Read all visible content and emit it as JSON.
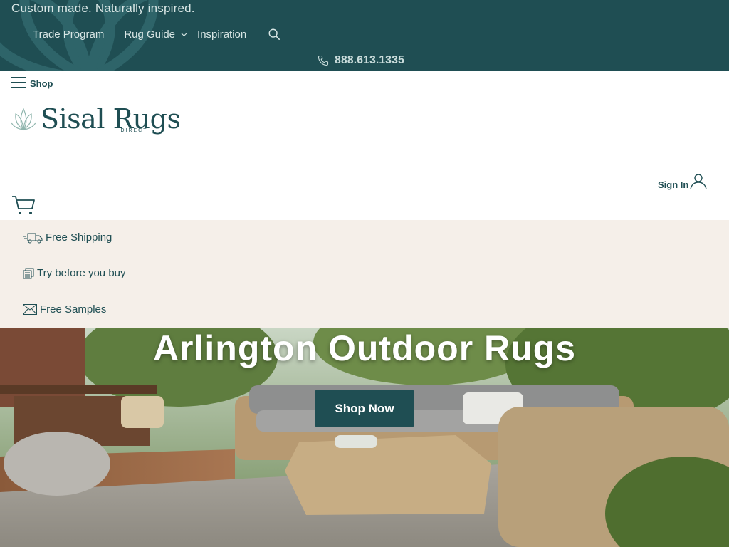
{
  "topbar": {
    "tagline": "Custom made. Naturally inspired.",
    "nav": [
      "Trade Program",
      "Rug Guide",
      "Inspiration"
    ],
    "phone": "888.613.1335",
    "color": "#1f4e53"
  },
  "header": {
    "shop_label": "Shop",
    "logo_name": "Sisal Rugs",
    "logo_sub": "DIRECT",
    "sign_in": "Sign In"
  },
  "benefits": [
    "Free Shipping",
    "Try before you buy",
    "Free Samples"
  ],
  "hero": {
    "title": "Arlington Outdoor Rugs",
    "button": "Shop Now"
  },
  "icons": [
    "lotus-icon",
    "chevron-down-icon",
    "search-icon",
    "phone-icon",
    "menu-icon",
    "user-icon",
    "cart-icon",
    "truck-icon",
    "swatch-icon",
    "envelope-icon"
  ]
}
